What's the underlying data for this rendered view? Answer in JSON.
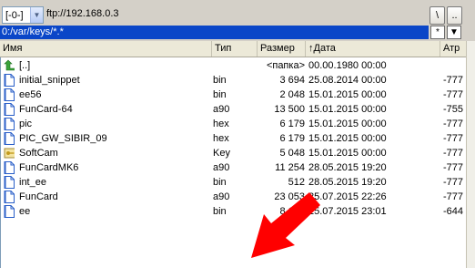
{
  "drive": {
    "value": "[-0-]"
  },
  "connection": {
    "label": "ftp://192.168.0.3"
  },
  "toolbar": {
    "root_label": "\\",
    "up_label": ".."
  },
  "path": {
    "value": "0:/var/keys/*.*",
    "star_label": "*",
    "dropdown_icon": "chevron-down-icon"
  },
  "columns": {
    "name": "Имя",
    "type": "Тип",
    "size": "Размер",
    "date": "↑Дата",
    "attr": "Атр"
  },
  "rows": [
    {
      "name": "[..]",
      "type": "",
      "size": "<папка>",
      "date": "00.00.1980 00:00",
      "attr": "",
      "icon": "up-arrow-icon"
    },
    {
      "name": "initial_snippet",
      "type": "bin",
      "size": "3 694",
      "date": "25.08.2014 00:00",
      "attr": "-777",
      "icon": "file-icon"
    },
    {
      "name": "ee56",
      "type": "bin",
      "size": "2 048",
      "date": "15.01.2015 00:00",
      "attr": "-777",
      "icon": "file-icon"
    },
    {
      "name": "FunCard-64",
      "type": "a90",
      "size": "13 500",
      "date": "15.01.2015 00:00",
      "attr": "-755",
      "icon": "file-icon"
    },
    {
      "name": "pic",
      "type": "hex",
      "size": "6 179",
      "date": "15.01.2015 00:00",
      "attr": "-777",
      "icon": "file-icon"
    },
    {
      "name": "PIC_GW_SIBIR_09",
      "type": "hex",
      "size": "6 179",
      "date": "15.01.2015 00:00",
      "attr": "-777",
      "icon": "file-icon"
    },
    {
      "name": "SoftCam",
      "type": "Key",
      "size": "5 048",
      "date": "15.01.2015 00:00",
      "attr": "-777",
      "icon": "key-file-icon"
    },
    {
      "name": "FunCardMK6",
      "type": "a90",
      "size": "11 254",
      "date": "28.05.2015 19:20",
      "attr": "-777",
      "icon": "file-icon"
    },
    {
      "name": "int_ee",
      "type": "bin",
      "size": "512",
      "date": "28.05.2015 19:20",
      "attr": "-777",
      "icon": "file-icon"
    },
    {
      "name": "FunCard",
      "type": "a90",
      "size": "23 053",
      "date": "25.07.2015 22:26",
      "attr": "-777",
      "icon": "file-icon"
    },
    {
      "name": "ee",
      "type": "bin",
      "size": "8 192",
      "date": "25.07.2015 23:01",
      "attr": "-644",
      "icon": "file-icon"
    }
  ],
  "colors": {
    "path_bg": "#0a46c8",
    "arrow": "#ff0000",
    "header_bg": "#ece9d8"
  }
}
